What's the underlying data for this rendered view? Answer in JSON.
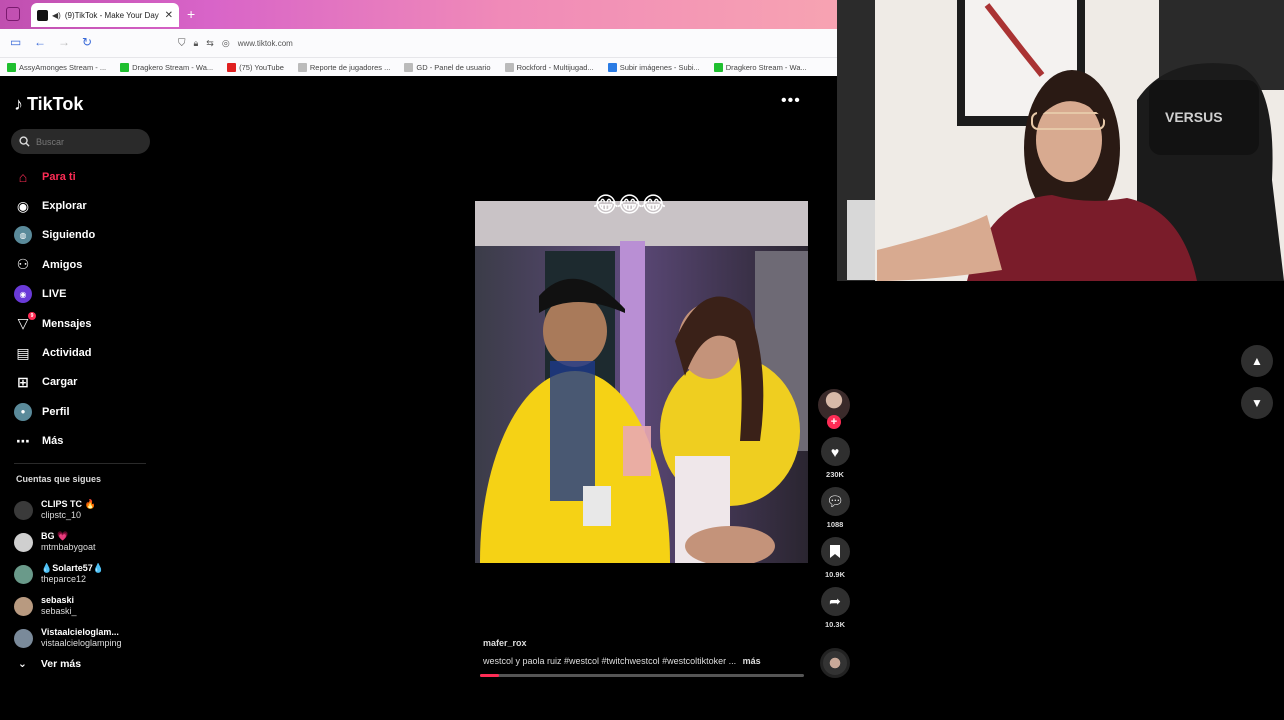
{
  "browser": {
    "tab_title": "(9)TikTok - Make Your Day",
    "url": "www.tiktok.com",
    "bookmarks": [
      {
        "label": "AssyAmonges Stream - ...",
        "color": "#1fbf2f"
      },
      {
        "label": "Dragkero Stream - Wa...",
        "color": "#1fbf2f"
      },
      {
        "label": "(75) YouTube",
        "color": "#e02020"
      },
      {
        "label": "Reporte de jugadores ...",
        "color": "#bbbbbb"
      },
      {
        "label": "GD - Panel de usuario",
        "color": "#bbbbbb"
      },
      {
        "label": "Rockford - Multijugad...",
        "color": "#bbbbbb"
      },
      {
        "label": "Subir imágenes - Subi...",
        "color": "#2a7be4"
      },
      {
        "label": "Dragkero Stream - Wa...",
        "color": "#1fbf2f"
      }
    ]
  },
  "tiktok": {
    "logo": "TikTok",
    "search_placeholder": "Buscar",
    "nav": [
      {
        "label": "Para ti",
        "icon": "home-icon",
        "active": true
      },
      {
        "label": "Explorar",
        "icon": "compass-icon"
      },
      {
        "label": "Siguiendo",
        "icon": "following-icon"
      },
      {
        "label": "Amigos",
        "icon": "friends-icon"
      },
      {
        "label": "LIVE",
        "icon": "live-icon"
      },
      {
        "label": "Mensajes",
        "icon": "messages-icon",
        "badge": "9"
      },
      {
        "label": "Actividad",
        "icon": "activity-icon"
      },
      {
        "label": "Cargar",
        "icon": "upload-icon"
      },
      {
        "label": "Perfil",
        "icon": "profile-icon"
      },
      {
        "label": "Más",
        "icon": "more-icon"
      }
    ],
    "following_title": "Cuentas que sigues",
    "following": [
      {
        "name": "CLIPS TC 🔥",
        "user": "clipstc_10"
      },
      {
        "name": "BG 💗",
        "user": "mtmbabygoat"
      },
      {
        "name": "💧Solarte57💧",
        "user": "theparce12"
      },
      {
        "name": "sebaski",
        "user": "sebaski_"
      },
      {
        "name": "Vistaalcieloglam...",
        "user": "vistaalcieloglamping"
      }
    ],
    "see_more": "Ver más"
  },
  "video": {
    "emoji_caption": "😂😂😂",
    "author": "mafer_rox",
    "caption": "westcol  y paola ruiz #westcol  #twitchwestcol  #westcoltiktoker ...",
    "more": "más",
    "progress": 0.06,
    "likes": "230K",
    "comments": "1088",
    "saves": "10.9K",
    "shares": "10.3K",
    "chair_brand": "VERSUS"
  },
  "colors": {
    "accent": "#fe2c55"
  }
}
